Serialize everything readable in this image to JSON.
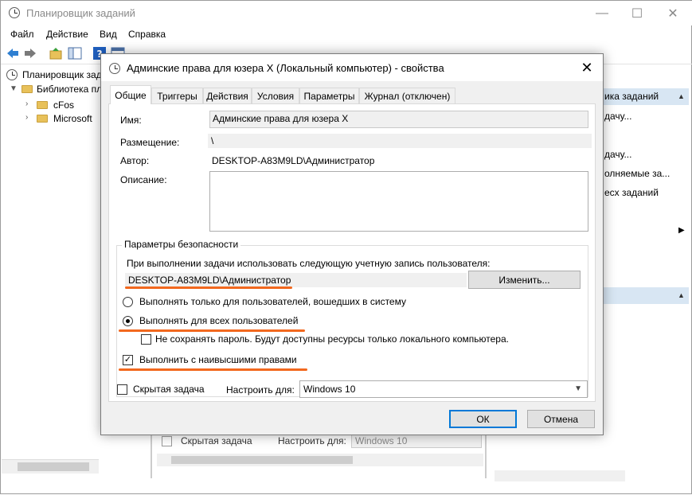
{
  "main_window": {
    "title": "Планировщик заданий",
    "controls": {
      "minimize": "—",
      "maximize": "☐",
      "close": "✕"
    },
    "menu": [
      "Файл",
      "Действие",
      "Вид",
      "Справка"
    ],
    "tree": {
      "root": "Планировщик задани",
      "library": "Библиотека пл",
      "children": [
        "cFos",
        "Microsoft"
      ]
    },
    "actions_panel": {
      "header": "ика заданий",
      "items": [
        "дачу...",
        "дачу...",
        "олняемые за...",
        "есх заданий"
      ],
      "arrow": "▶"
    },
    "background_dialog": {
      "hidden_task": "Скрытая задача",
      "configure_for": "Настроить для:",
      "os_value": "Windows 10"
    }
  },
  "dialog": {
    "title": "Админские права для юзера X (Локальный компьютер) - свойства",
    "close": "✕",
    "tabs": [
      "Общие",
      "Триггеры",
      "Действия",
      "Условия",
      "Параметры",
      "Журнал (отключен)"
    ],
    "general": {
      "name_label": "Имя:",
      "name_value": "Админские права для юзера X",
      "location_label": "Размещение:",
      "location_value": "\\",
      "author_label": "Автор:",
      "author_value": "DESKTOP-A83M9LD\\Администратор",
      "description_label": "Описание:",
      "description_value": ""
    },
    "security": {
      "legend": "Параметры безопасности",
      "account_prompt": "При выполнении задачи использовать следующую учетную запись пользователя:",
      "account_value": "DESKTOP-A83M9LD\\Администратор",
      "change_button": "Изменить...",
      "radio_logged_on": "Выполнять только для пользователей, вошедших в систему",
      "radio_all_users": "Выполнять для всех пользователей",
      "radio_selected": "all_users",
      "no_store_password": "Не сохранять пароль. Будут доступны ресурсы только локального компьютера.",
      "no_store_password_checked": false,
      "highest_privileges": "Выполнить с наивысшими правами",
      "highest_privileges_checked": true,
      "check_mark": "✓"
    },
    "hidden_task": "Скрытая задача",
    "hidden_task_checked": false,
    "configure_for_label": "Настроить для:",
    "configure_for_value": "Windows 10",
    "select_arrow": "▼",
    "ok_button": "ОК",
    "cancel_button": "Отмена"
  },
  "colors": {
    "highlight_underline": "#f2681e",
    "default_button_border": "#0078d7",
    "actions_header_bg": "#d8e6f3"
  }
}
